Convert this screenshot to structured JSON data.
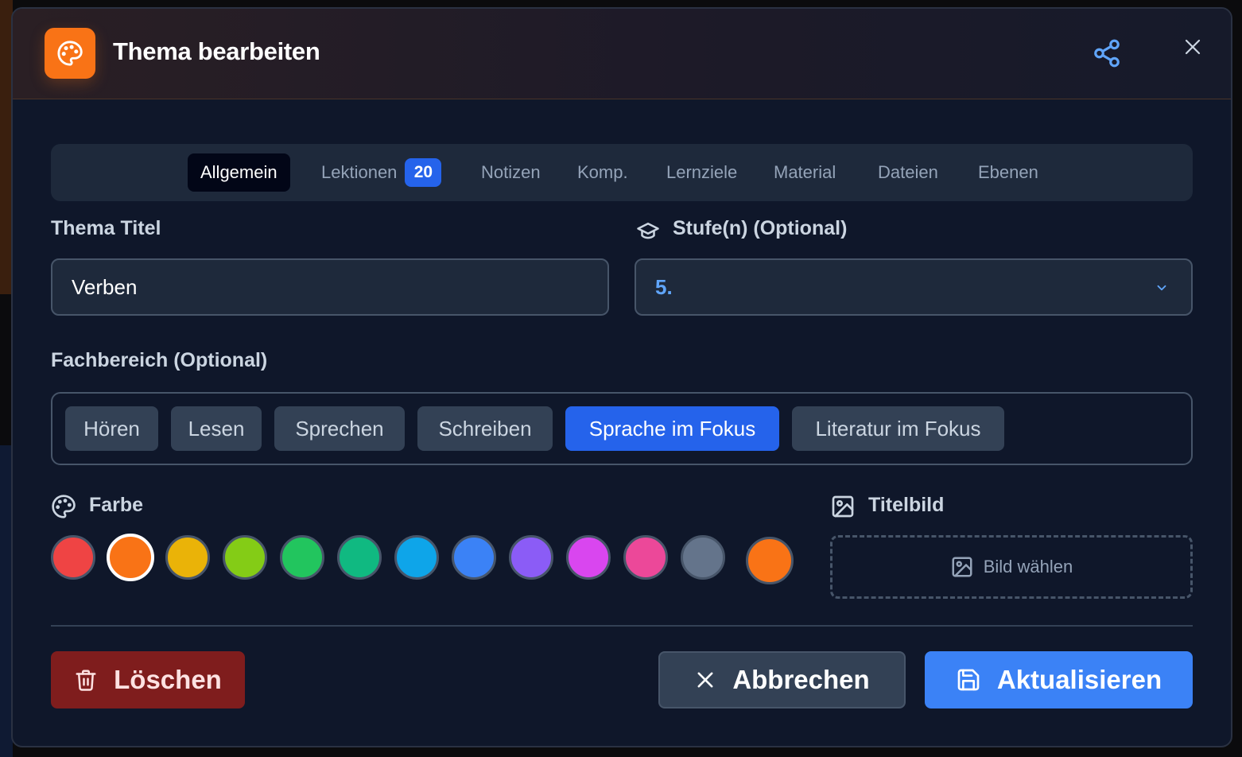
{
  "header": {
    "title": "Thema bearbeiten",
    "icon": "palette-icon",
    "share_icon": "share-icon",
    "close_icon": "close-icon"
  },
  "tabs": [
    {
      "label": "Allgemein",
      "active": true
    },
    {
      "label": "Lektionen",
      "badge": "20"
    },
    {
      "label": "Notizen"
    },
    {
      "label": "Komp."
    },
    {
      "label": "Lernziele"
    },
    {
      "label": "Material"
    },
    {
      "label": "Dateien"
    },
    {
      "label": "Ebenen"
    }
  ],
  "title_field": {
    "label": "Thema Titel",
    "value": "Verben"
  },
  "level_field": {
    "label": "Stufe(n) (Optional)",
    "icon": "graduation-cap-icon",
    "value": "5."
  },
  "subject_area": {
    "label": "Fachbereich (Optional)",
    "options": [
      "Hören",
      "Lesen",
      "Sprechen",
      "Schreiben",
      "Sprache im Fokus",
      "Literatur im Fokus"
    ],
    "selected": "Sprache im Fokus"
  },
  "color": {
    "label": "Farbe",
    "icon": "palette-icon",
    "swatches": [
      "#ef4444",
      "#f97316",
      "#eab308",
      "#84cc16",
      "#22c55e",
      "#10b981",
      "#0ea5e9",
      "#3b82f6",
      "#8b5cf6",
      "#d946ef",
      "#ec4899",
      "#64748b",
      "#f97316"
    ],
    "selected_index": 1
  },
  "cover_image": {
    "label": "Titelbild",
    "icon": "image-icon",
    "button_label": "Bild wählen"
  },
  "actions": {
    "delete_label": "Löschen",
    "cancel_label": "Abbrechen",
    "update_label": "Aktualisieren"
  },
  "colors": {
    "accent": "#3b82f6",
    "danger": "#7f1d1d",
    "brand": "#f97316"
  }
}
